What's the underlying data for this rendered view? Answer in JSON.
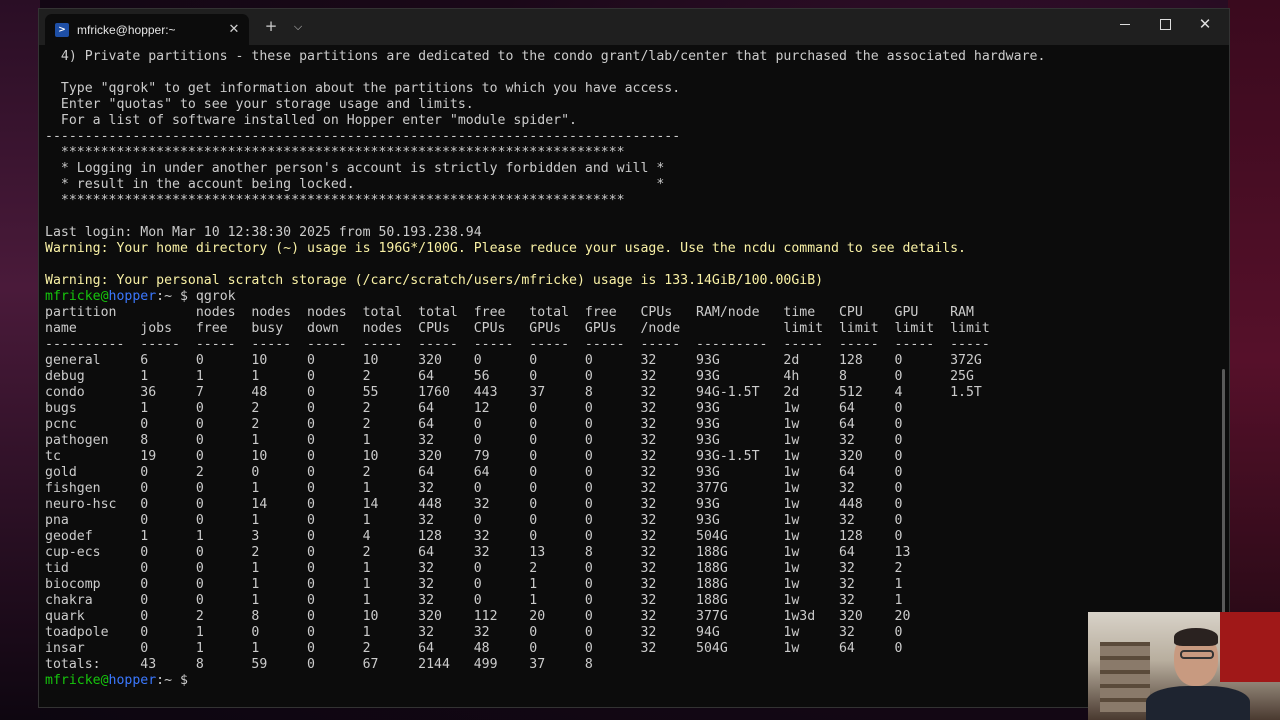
{
  "window": {
    "tab_title": "mfricke@hopper:~",
    "tab_icon": "powershell-icon",
    "new_tab": "+",
    "dropdown": "⌵",
    "close_tab": "✕"
  },
  "terminal": {
    "lines": [
      {
        "t": "  4) Private partitions - these partitions are dedicated to the condo grant/lab/center that purchased the associated hardware."
      },
      {
        "t": ""
      },
      {
        "t": "  Type \"qgrok\" to get information about the partitions to which you have access."
      },
      {
        "t": "  Enter \"quotas\" to see your storage usage and limits."
      },
      {
        "t": "  For a list of software installed on Hopper enter \"module spider\"."
      },
      {
        "t": "--------------------------------------------------------------------------------"
      },
      {
        "t": "  ***********************************************************************"
      },
      {
        "t": "  * Logging in under another person's account is strictly forbidden and will *"
      },
      {
        "t": "  * result in the account being locked.                                      *"
      },
      {
        "t": "  ***********************************************************************"
      },
      {
        "t": ""
      },
      {
        "t": "Last login: Mon Mar 10 12:38:30 2025 from 50.193.238.94"
      },
      {
        "t": "Warning: Your home directory (~) usage is 196G*/100G. Please reduce your usage. Use the ncdu command to see details.",
        "warn": true
      },
      {
        "t": ""
      },
      {
        "t": "Warning: Your personal scratch storage (/carc/scratch/users/mfricke) usage is 133.14GiB/100.00GiB)",
        "warn": true
      },
      {
        "prompt": true,
        "cmd": " qgrok"
      },
      {
        "t": "partition          nodes  nodes  nodes  total  total  free   total  free   CPUs   RAM/node   time   CPU    GPU    RAM"
      },
      {
        "t": "name        jobs   free   busy   down   nodes  CPUs   CPUs   GPUs   GPUs   /node             limit  limit  limit  limit"
      },
      {
        "t": "----------  -----  -----  -----  -----  -----  -----  -----  -----  -----  -----  ---------  -----  -----  -----  -----"
      },
      {
        "t": "general     6      0      10     0      10     320    0      0      0      32     93G        2d     128    0      372G"
      },
      {
        "t": "debug       1      1      1      0      2      64     56     0      0      32     93G        4h     8      0      25G"
      },
      {
        "t": "condo       36     7      48     0      55     1760   443    37     8      32     94G-1.5T   2d     512    4      1.5T"
      },
      {
        "t": "bugs        1      0      2      0      2      64     12     0      0      32     93G        1w     64     0"
      },
      {
        "t": "pcnc        0      0      2      0      2      64     0      0      0      32     93G        1w     64     0"
      },
      {
        "t": "pathogen    8      0      1      0      1      32     0      0      0      32     93G        1w     32     0"
      },
      {
        "t": "tc          19     0      10     0      10     320    79     0      0      32     93G-1.5T   1w     320    0"
      },
      {
        "t": "gold        0      2      0      0      2      64     64     0      0      32     93G        1w     64     0"
      },
      {
        "t": "fishgen     0      0      1      0      1      32     0      0      0      32     377G       1w     32     0"
      },
      {
        "t": "neuro-hsc   0      0      14     0      14     448    32     0      0      32     93G        1w     448    0"
      },
      {
        "t": "pna         0      0      1      0      1      32     0      0      0      32     93G        1w     32     0"
      },
      {
        "t": "geodef      1      1      3      0      4      128    32     0      0      32     504G       1w     128    0"
      },
      {
        "t": "cup-ecs     0      0      2      0      2      64     32     13     8      32     188G       1w     64     13"
      },
      {
        "t": "tid         0      0      1      0      1      32     0      2      0      32     188G       1w     32     2"
      },
      {
        "t": "biocomp     0      0      1      0      1      32     0      1      0      32     188G       1w     32     1"
      },
      {
        "t": "chakra      0      0      1      0      1      32     0      1      0      32     188G       1w     32     1"
      },
      {
        "t": "quark       0      2      8      0      10     320    112    20     0      32     377G       1w3d   320    20"
      },
      {
        "t": "toadpole    0      1      0      0      1      32     32     0      0      32     94G        1w     32     0"
      },
      {
        "t": "insar       0      1      1      0      2      64     48     0      0      32     504G       1w     64     0"
      },
      {
        "t": "totals:     43     8      59     0      67     2144   499    37     8"
      },
      {
        "prompt": true,
        "cmd": " "
      }
    ],
    "prompt_user": "mfricke",
    "prompt_at": "@",
    "prompt_host": "hopper",
    "prompt_tail": ":~ $"
  }
}
